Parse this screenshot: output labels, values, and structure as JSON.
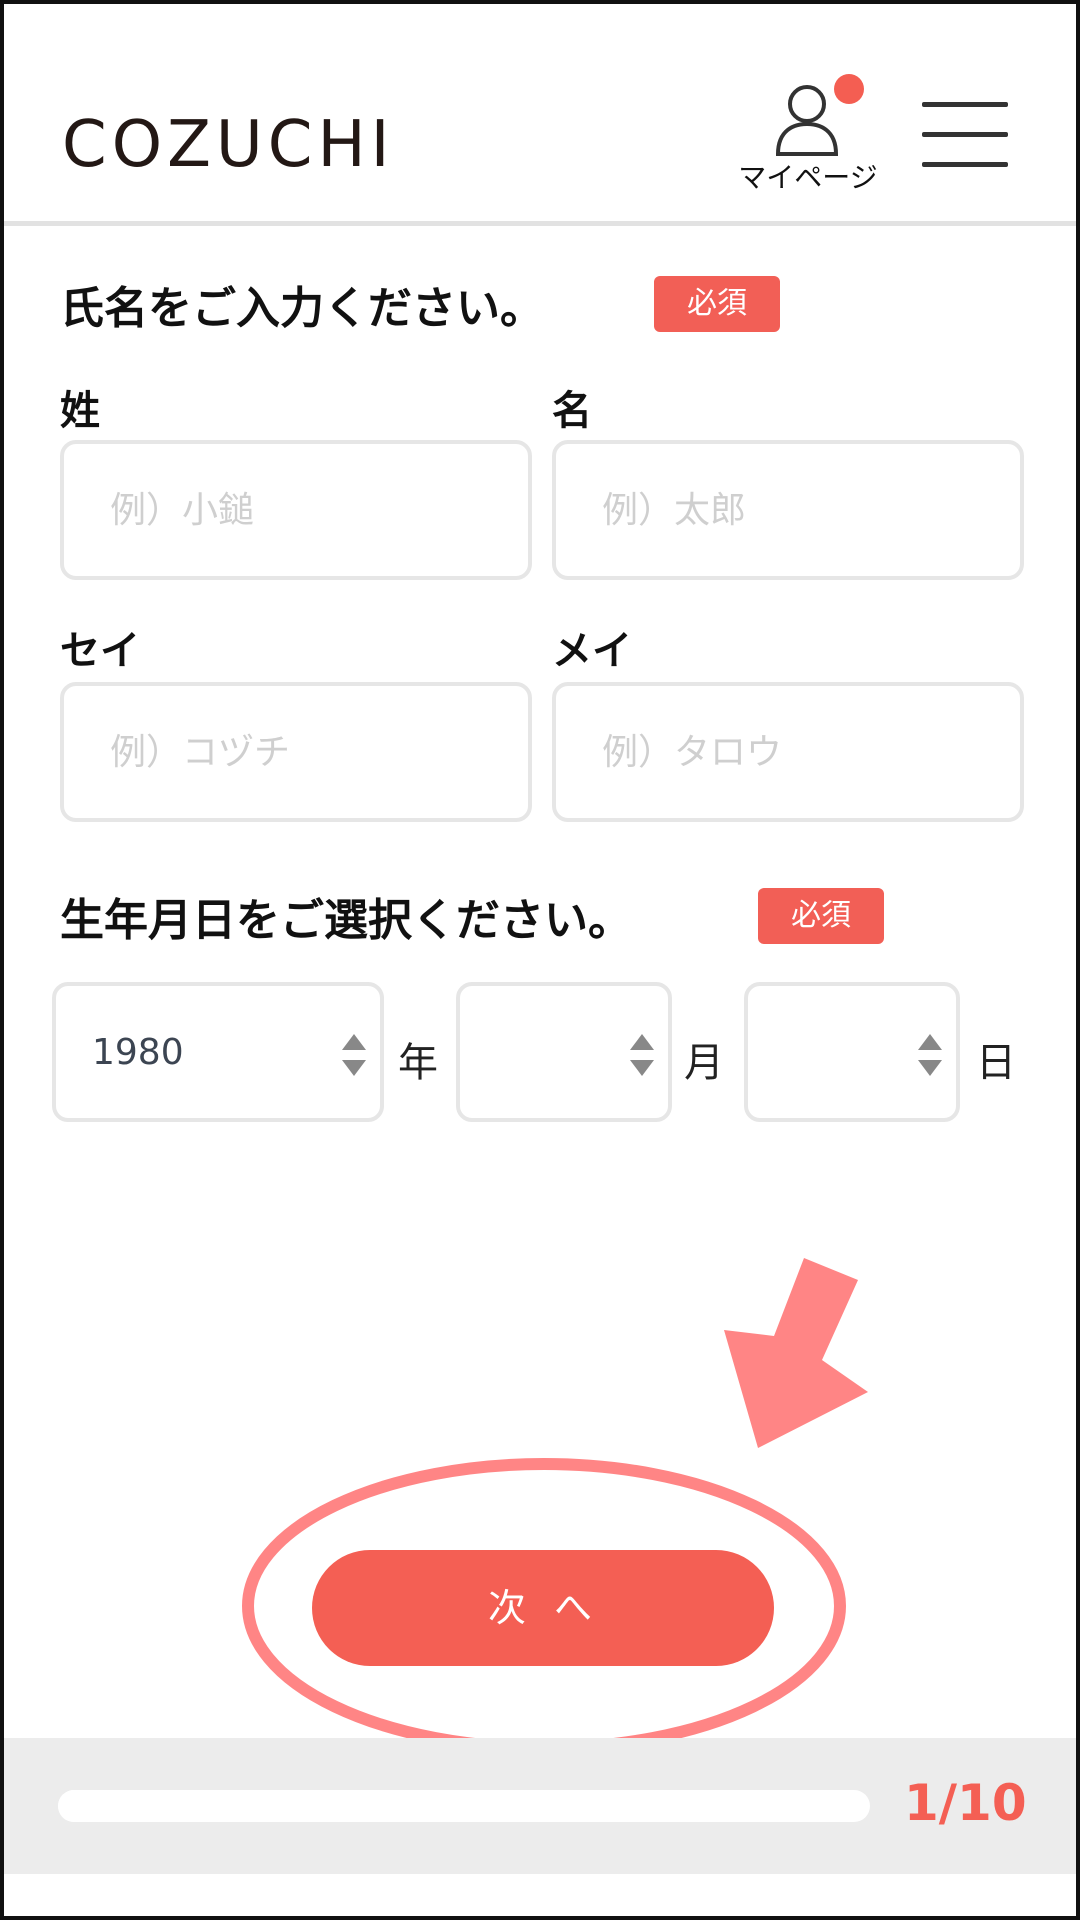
{
  "header": {
    "logo": "COZUCHI",
    "mypage_label": "マイページ",
    "has_notification": true
  },
  "name_section": {
    "title": "氏名をご入力ください。",
    "required_label": "必須",
    "fields": {
      "last_name": {
        "label": "姓",
        "placeholder": "例）小鎚",
        "value": ""
      },
      "first_name": {
        "label": "名",
        "placeholder": "例）太郎",
        "value": ""
      },
      "last_name_kana": {
        "label": "セイ",
        "placeholder": "例）コヅチ",
        "value": ""
      },
      "first_name_kana": {
        "label": "メイ",
        "placeholder": "例）タロウ",
        "value": ""
      }
    }
  },
  "birth_section": {
    "title": "生年月日をご選択ください。",
    "required_label": "必須",
    "year": {
      "value": "1980",
      "unit": "年"
    },
    "month": {
      "value": "",
      "unit": "月"
    },
    "day": {
      "value": "",
      "unit": "日"
    }
  },
  "next_button": {
    "label": "次へ"
  },
  "progress": {
    "text": "1/10",
    "current": 1,
    "total": 10
  },
  "colors": {
    "accent": "#f45f54",
    "annotation": "#ff8585",
    "border": "#e6e6e6",
    "footer_bg": "#ececec"
  },
  "icons": {
    "mypage": "person-icon",
    "menu": "hamburger-menu-icon",
    "spinner": "up-down-spinner-icon"
  }
}
